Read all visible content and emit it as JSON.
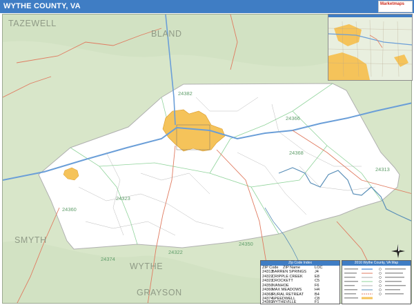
{
  "header": {
    "title": "WYTHE COUNTY, VA",
    "logo_text": "Marketmaps"
  },
  "colors": {
    "header_bar": "#3f7dc4",
    "surrounding_land": "#d8e6c9",
    "county_fill": "#ffffff",
    "urban_area": "#f5c35a",
    "interstate": "#6a9ed8",
    "highway": "#e07a5f",
    "river": "#5a8fb8",
    "zip_boundary": "#8fd39a"
  },
  "map": {
    "neighbor_counties": [
      {
        "name": "TAZEWELL"
      },
      {
        "name": "BLAND"
      },
      {
        "name": "SMYTH"
      },
      {
        "name": "WYTHE"
      },
      {
        "name": "GRAYSON"
      }
    ],
    "zip_labels": [
      "24382",
      "24368",
      "24313",
      "24323",
      "24350",
      "24360",
      "24322",
      "24374",
      "24366"
    ]
  },
  "inset": {
    "name": "locator-inset"
  },
  "zip_index": {
    "title": "Zip Code Index",
    "columns": [
      "ZIP Code",
      "ZIP Name",
      "LOC"
    ],
    "rows": [
      {
        "zip": "24313",
        "name": "BARREN SPRINGS",
        "loc": "J4"
      },
      {
        "zip": "24322",
        "name": "CRIPPLE CREEK",
        "loc": "E8"
      },
      {
        "zip": "24323",
        "name": "CROCKETT",
        "loc": "C5"
      },
      {
        "zip": "24350",
        "name": "IVANHOE",
        "loc": "F6"
      },
      {
        "zip": "24360",
        "name": "MAX MEADOWS",
        "loc": "H4"
      },
      {
        "zip": "24368",
        "name": "RURAL RETREAT",
        "loc": "B4"
      },
      {
        "zip": "24374",
        "name": "SPEEDWELL",
        "loc": "C8"
      },
      {
        "zip": "24382",
        "name": "WYTHEVILLE",
        "loc": "F1"
      }
    ]
  },
  "legend": {
    "title": "2016 Wythe County, VA Map"
  },
  "compass": {
    "label": "N"
  }
}
